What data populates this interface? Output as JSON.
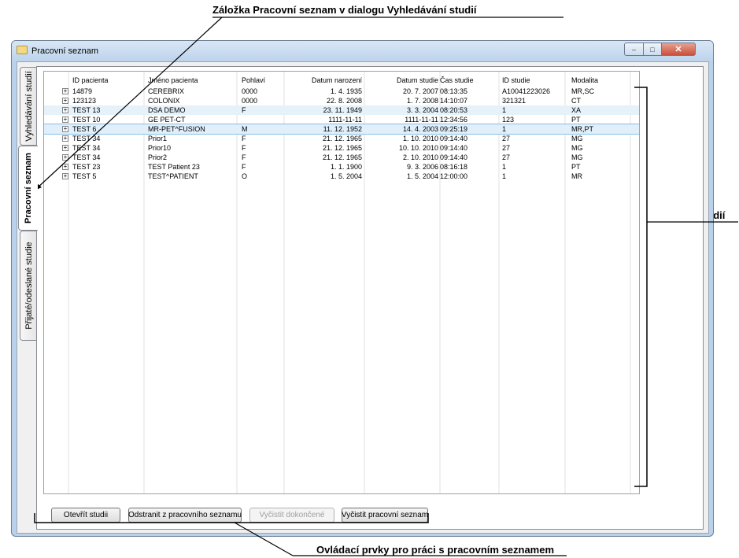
{
  "annotations": {
    "top": "Záložka Pracovní seznam v dialogu Vyhledávání studií",
    "right": "Seznam studií",
    "bottom": "Ovládací prvky pro práci s pracovním seznamem"
  },
  "window": {
    "title": "Pracovní seznam",
    "controls": {
      "minimize": "–",
      "maximize": "□",
      "close": "✕"
    }
  },
  "tabs": [
    {
      "label": "Vyhledávání studií",
      "active": false
    },
    {
      "label": "Pracovní seznam",
      "active": true
    },
    {
      "label": "Přijaté/odeslané studie",
      "active": false
    }
  ],
  "table": {
    "columns": [
      "ID pacienta",
      "Jméno pacienta",
      "Pohlaví",
      "Datum narození",
      "Datum studie",
      "Čas studie",
      "ID studie",
      "Modalita"
    ],
    "rows": [
      {
        "expand": "+",
        "id": "14879",
        "name": "CEREBRIX",
        "sex": "0000",
        "dob": "1. 4. 1935",
        "study_date": "20. 7. 2007",
        "study_time": "08:13:35",
        "study_id": "A10041223026",
        "modality": "MR,SC"
      },
      {
        "expand": "+",
        "id": "123123",
        "name": "COLONIX",
        "sex": "0000",
        "dob": "22. 8. 2008",
        "study_date": "1. 7. 2008",
        "study_time": "14:10:07",
        "study_id": "321321",
        "modality": "CT"
      },
      {
        "expand": "+",
        "id": "TEST 13",
        "name": "DSA DEMO",
        "sex": "F",
        "dob": "23. 11. 1949",
        "study_date": "3. 3. 2004",
        "study_time": "08:20:53",
        "study_id": "1",
        "modality": "XA"
      },
      {
        "expand": "+",
        "id": "TEST 10",
        "name": "GE PET-CT",
        "sex": "",
        "dob": "1111-11-11",
        "study_date": "1111-11-11",
        "study_time": "12:34:56",
        "study_id": "123",
        "modality": "PT"
      },
      {
        "expand": "+",
        "id": "TEST 6",
        "name": "MR-PET^FUSION",
        "sex": "M",
        "dob": "11. 12. 1952",
        "study_date": "14. 4. 2003",
        "study_time": "09:25:19",
        "study_id": "1",
        "modality": "MR,PT"
      },
      {
        "expand": "+",
        "id": "TEST 34",
        "name": "Prior1",
        "sex": "F",
        "dob": "21. 12. 1965",
        "study_date": "1. 10. 2010",
        "study_time": "09:14:40",
        "study_id": "27",
        "modality": "MG"
      },
      {
        "expand": "+",
        "id": "TEST 34",
        "name": "Prior10",
        "sex": "F",
        "dob": "21. 12. 1965",
        "study_date": "10. 10. 2010",
        "study_time": "09:14:40",
        "study_id": "27",
        "modality": "MG"
      },
      {
        "expand": "+",
        "id": "TEST 34",
        "name": "Prior2",
        "sex": "F",
        "dob": "21. 12. 1965",
        "study_date": "2. 10. 2010",
        "study_time": "09:14:40",
        "study_id": "27",
        "modality": "MG"
      },
      {
        "expand": "+",
        "id": "TEST 23",
        "name": "TEST Patient 23",
        "sex": "F",
        "dob": "1. 1. 1900",
        "study_date": "9. 3. 2006",
        "study_time": "08:16:18",
        "study_id": "1",
        "modality": "PT"
      },
      {
        "expand": "+",
        "id": "TEST 5",
        "name": "TEST^PATIENT",
        "sex": "O",
        "dob": "1. 5. 2004",
        "study_date": "1. 5. 2004",
        "study_time": "12:00:00",
        "study_id": "1",
        "modality": "MR"
      }
    ]
  },
  "buttons": [
    {
      "label": "Otevřít studii",
      "enabled": true
    },
    {
      "label": "Odstranit z pracovního seznamu",
      "enabled": true
    },
    {
      "label": "Vyčistit dokončené",
      "enabled": false
    },
    {
      "label": "Vyčistit pracovní seznam",
      "enabled": true
    }
  ]
}
